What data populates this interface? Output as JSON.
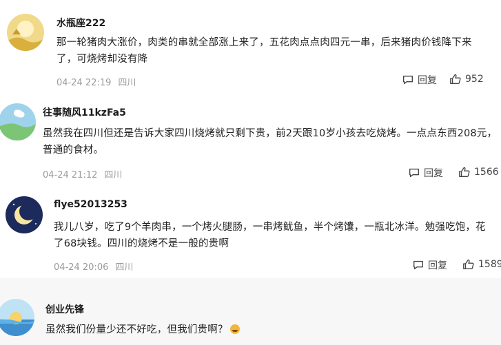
{
  "comments": [
    {
      "username": "水瓶座222",
      "content": "那一轮猪肉大涨价，肉类的串就全部涨上来了，五花肉点点肉四元一串，后来猪肉价钱降下来了，可烧烤却没有降",
      "time": "04-24 22:19",
      "location": "四川",
      "reply_label": "回复",
      "likes": "952"
    },
    {
      "username": "往事随风11kzFa5",
      "content": "虽然我在四川但还是告诉大家四川烧烤就只剩下贵，前2天跟10岁小孩去吃烧烤。一点点东西208元，普通的食材。",
      "time": "04-24 21:12",
      "location": "四川",
      "reply_label": "回复",
      "likes": "1566"
    },
    {
      "username": "flye52013253",
      "content": "我儿八岁，吃了9个羊肉串，一个烤火腿肠，一串烤鱿鱼，半个烤馕，一瓶北冰洋。勉强吃饱，花了68块钱。四川的烧烤不是一般的贵啊",
      "time": "04-24 20:06",
      "location": "四川",
      "reply_label": "回复",
      "likes": "1589"
    },
    {
      "username": "创业先锋",
      "content": "虽然我们份量少还不好吃，但我们贵啊？"
    }
  ],
  "icons": {
    "reply": "comment-bubble-icon",
    "like": "thumbs-up-icon",
    "emoji": "grin-emoji-icon"
  }
}
